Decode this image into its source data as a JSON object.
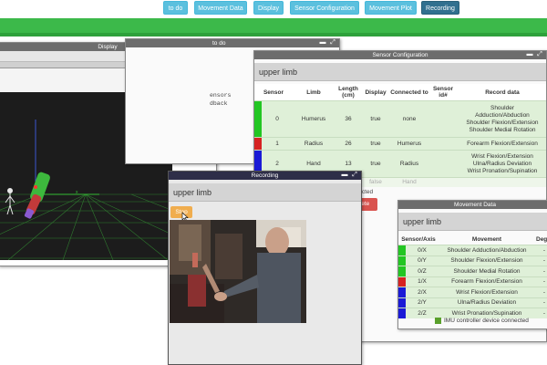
{
  "nav": {
    "buttons": [
      "to do",
      "Movement Data",
      "Display",
      "Sensor Configuration",
      "Movement Plot",
      "Recording"
    ],
    "active": "Recording"
  },
  "display_window": {
    "title": "Display",
    "gizmo_label": "x"
  },
  "todo_window": {
    "title": "to do",
    "text_line1": "ensors",
    "text_line2": "dback"
  },
  "sensor_window": {
    "title": "Sensor Configuration",
    "heading": "upper limb",
    "columns": [
      "Sensor",
      "Limb",
      "Length (cm)",
      "Display",
      "Connected to",
      "Sensor id#",
      "Record data"
    ],
    "rows": [
      {
        "sensor": "0",
        "limb": "Humerus",
        "length": "36",
        "display": "true",
        "connected": "none",
        "id": "",
        "record": [
          "Shoulder",
          "Adduction/Abduction",
          "Shoulder Flexion/Extension",
          "Shoulder Medial Rotation"
        ],
        "color": "#22c622"
      },
      {
        "sensor": "1",
        "limb": "Radius",
        "length": "26",
        "display": "true",
        "connected": "Humerus",
        "id": "",
        "record": [
          "Forearm Flexion/Extension"
        ],
        "color": "#d62222"
      },
      {
        "sensor": "2",
        "limb": "Hand",
        "length": "13",
        "display": "true",
        "connected": "Radius",
        "id": "",
        "record": [
          "Wrist Flexion/Extension",
          "Ulna/Radius Deviation",
          "Wrist Pronation/Supination"
        ],
        "color": "#1a1ad6"
      }
    ],
    "ghost_row": {
      "display": "false",
      "connected": "Hand"
    },
    "connected_text": "nnected",
    "delete_label": "lete"
  },
  "movement_window": {
    "title": "Movement Data",
    "heading": "upper limb",
    "columns": [
      "Sensor/Axis",
      "Movement",
      "Deg"
    ],
    "rows": [
      {
        "axis": "0/X",
        "movement": "Shoulder Adduction/Abduction",
        "deg": "-",
        "color": "#22c622"
      },
      {
        "axis": "0/Y",
        "movement": "Shoulder Flexion/Extension",
        "deg": "-",
        "color": "#22c622"
      },
      {
        "axis": "0/Z",
        "movement": "Shoulder Medial Rotation",
        "deg": "-",
        "color": "#22c622"
      },
      {
        "axis": "1/X",
        "movement": "Forearm Flexion/Extension",
        "deg": "-",
        "color": "#d62222"
      },
      {
        "axis": "2/X",
        "movement": "Wrist Flexion/Extension",
        "deg": "-",
        "color": "#1a1ad6"
      },
      {
        "axis": "2/Y",
        "movement": "Ulna/Radius Deviation",
        "deg": "-",
        "color": "#1a1ad6"
      },
      {
        "axis": "2/Z",
        "movement": "Wrist Pronation/Supination",
        "deg": "-",
        "color": "#1a1ad6"
      }
    ],
    "status_text": "IMU controller device connected",
    "status_color": "#5aa02c"
  },
  "recording_window": {
    "title": "Recording",
    "heading": "upper limb",
    "stop_label": "Stop"
  },
  "colors": {
    "nav_button": "#5bc0de",
    "nav_active": "#31708f",
    "green_bar": "#3cb94a",
    "row_green": "#dff0d8",
    "stop_button": "#f0ad4e",
    "delete_button": "#d9534f"
  }
}
